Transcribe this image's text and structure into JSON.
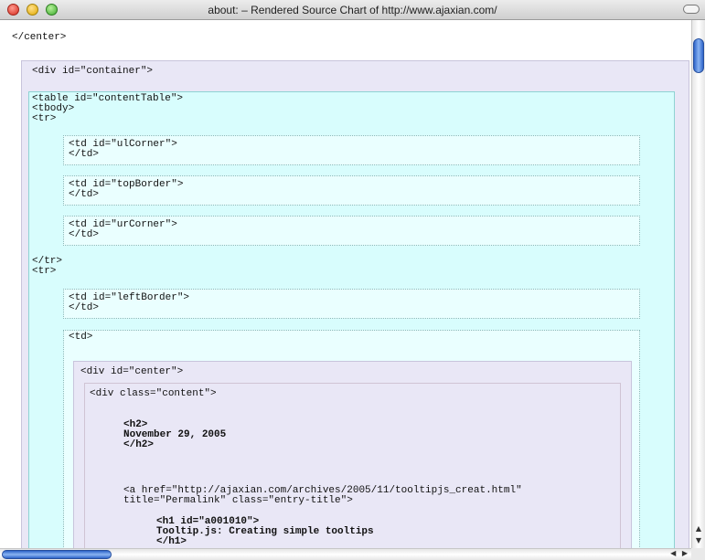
{
  "window": {
    "title": "about: – Rendered Source Chart of http://www.ajaxian.com/"
  },
  "source": {
    "top_close": "</center>",
    "container_open": "<div id=\"container\">",
    "table_lines": [
      "<table id=\"contentTable\">",
      "<tbody>",
      "<tr>"
    ],
    "td_ulcorner": [
      "<td id=\"ulCorner\">",
      "</td>"
    ],
    "td_topborder": [
      "<td id=\"topBorder\">",
      "</td>"
    ],
    "td_urcorner": [
      "<td id=\"urCorner\">",
      "</td>"
    ],
    "row_break": [
      "</tr>",
      "<tr>"
    ],
    "td_leftborder": [
      "<td id=\"leftBorder\">",
      "</td>"
    ],
    "td_open": "<td>",
    "center_open": "<div id=\"center\">",
    "content_open": "<div class=\"content\">",
    "h2": [
      "<h2>",
      "November 29, 2005",
      "</h2>"
    ],
    "anchor": [
      "<a href=\"http://ajaxian.com/archives/2005/11/tooltipjs_creat.html\"",
      "title=\"Permalink\" class=\"entry-title\">"
    ],
    "h1": [
      "<h1 id=\"a001010\">",
      "Tooltip.js: Creating simple tooltips",
      "</h1>"
    ]
  },
  "scrollbars": {
    "vertical_arrows": [
      "▲",
      "▼"
    ],
    "horizontal_arrows": "◀ ▶"
  },
  "colors": {
    "container_bg": "#e9e7f6",
    "table_bg": "#d8fdfd",
    "cell_bg": "#eaffff",
    "scroll_thumb": "#4a7fdc"
  }
}
